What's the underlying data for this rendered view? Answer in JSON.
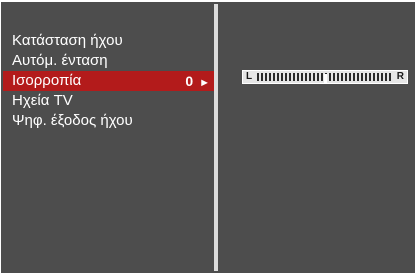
{
  "menu": {
    "items": [
      {
        "label": "Κατάσταση ήχου"
      },
      {
        "label": "Αυτόμ. ένταση"
      },
      {
        "label": "Ισορροπία",
        "value": "0",
        "arrow": "►",
        "selected": true
      },
      {
        "label": "Ηχεία TV"
      },
      {
        "label": "Ψηφ. έξοδος ήχου"
      }
    ]
  },
  "balance": {
    "left_label": "L",
    "right_label": "R",
    "value": 0,
    "range": [
      -50,
      50
    ]
  },
  "colors": {
    "background": "#4d4d4d",
    "highlight": "#b31b1b",
    "text": "#ffffff",
    "divider": "#dcdcdc"
  }
}
